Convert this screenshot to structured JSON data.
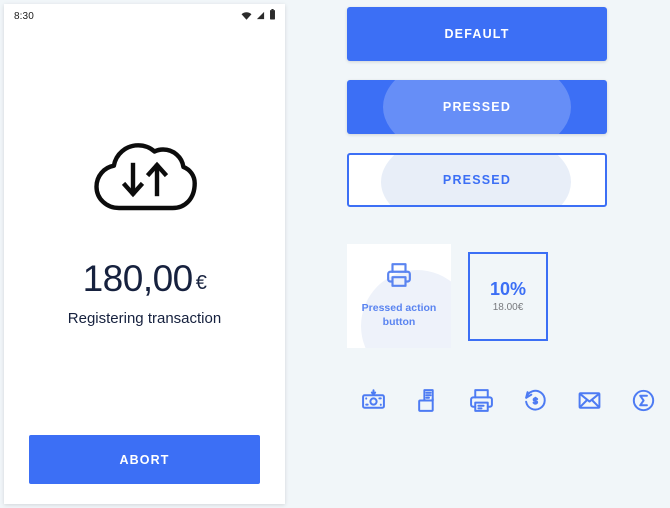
{
  "phone": {
    "status_bar": {
      "time": "8:30",
      "icons": [
        "wifi-icon",
        "signal-icon",
        "battery-icon"
      ]
    },
    "illustration_icon": "cloud-sync-icon",
    "amount": "180,00",
    "currency": "€",
    "status_text": "Registering transaction",
    "abort_label": "ABORT"
  },
  "components": {
    "button_default_label": "DEFAULT",
    "button_pressed_filled_label": "PRESSED",
    "button_pressed_outline_label": "PRESSED",
    "action_card": {
      "icon": "printer-icon",
      "label": "Pressed action button"
    },
    "tip_card": {
      "percent": "10%",
      "amount": "18.00€"
    },
    "icon_row": [
      {
        "name": "cash-deposit-icon",
        "title": "Cash"
      },
      {
        "name": "receipt-printer-icon",
        "title": "Receipt"
      },
      {
        "name": "printer-icon",
        "title": "Print"
      },
      {
        "name": "refund-icon",
        "title": "Refund"
      },
      {
        "name": "email-icon",
        "title": "Email"
      },
      {
        "name": "sum-sigma-icon",
        "title": "Totals"
      }
    ]
  },
  "colors": {
    "accent_blue": "#3c6ff5",
    "accent_blue_light": "#5a84f0",
    "page_background": "#f1f6f9",
    "text_dark": "#16213e",
    "text_muted": "#77797d"
  }
}
